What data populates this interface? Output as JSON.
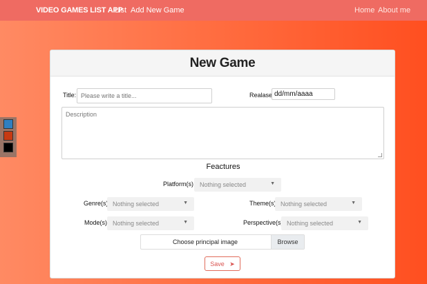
{
  "navbar": {
    "brand": "VIDEO GAMES LIST APP",
    "left_links": [
      "List",
      "Add New Game"
    ],
    "right_links": [
      "Home",
      "About me"
    ]
  },
  "palette": {
    "colors": [
      "#2f7fc1",
      "#c63a13",
      "#000000"
    ]
  },
  "form": {
    "title": "New Game",
    "title_label": "Title:",
    "title_placeholder": "Please write a title...",
    "release_label": "Realase:",
    "release_value": "dd/mm/aaaa",
    "description_placeholder": "Description",
    "features_title": "Feactures",
    "platform_label": "Platform(s)",
    "genre_label": "Genre(s)",
    "theme_label": "Theme(s)",
    "mode_label": "Mode(s)",
    "perspective_label": "Perspective(s)",
    "select_placeholder": "Nothing selected",
    "file_label": "Choose principal image",
    "browse_label": "Browse",
    "save_label": "Save"
  },
  "icons": {
    "chevron": "chevron-down-icon",
    "send": "paper-plane-icon"
  }
}
